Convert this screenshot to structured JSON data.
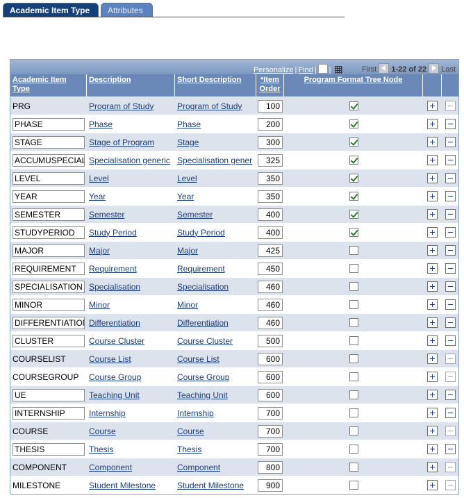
{
  "tabs": [
    {
      "label": "Academic Item Type",
      "active": true
    },
    {
      "label": "Attributes",
      "active": false
    }
  ],
  "nav": {
    "personalize": "Personalize",
    "find": "Find",
    "first": "First",
    "range": "1-22 of 22",
    "last": "Last"
  },
  "headers": {
    "academic_item_type": "Academic Item Type",
    "description": "Description",
    "short_description": "Short Description",
    "item_order": "*Item Order",
    "program_format_tree_node": "Program Format Tree Node"
  },
  "rows": [
    {
      "type": "PRG",
      "editable": false,
      "description": "Program of Study",
      "short": "Program of Study",
      "order": "100",
      "tree_node": true,
      "can_delete": false
    },
    {
      "type": "PHASE",
      "editable": true,
      "description": "Phase",
      "short": "Phase",
      "order": "200",
      "tree_node": true,
      "can_delete": true
    },
    {
      "type": "STAGE",
      "editable": true,
      "description": "Stage of Program",
      "short": "Stage",
      "order": "300",
      "tree_node": true,
      "can_delete": true
    },
    {
      "type": "ACCUMUSPECIAL",
      "editable": true,
      "description": "Specialisation generic",
      "short": "Specialisation gener",
      "order": "325",
      "tree_node": true,
      "can_delete": true
    },
    {
      "type": "LEVEL",
      "editable": true,
      "description": "Level",
      "short": "Level",
      "order": "350",
      "tree_node": true,
      "can_delete": true
    },
    {
      "type": "YEAR",
      "editable": true,
      "description": "Year",
      "short": "Year",
      "order": "350",
      "tree_node": true,
      "can_delete": true
    },
    {
      "type": "SEMESTER",
      "editable": true,
      "description": "Semester",
      "short": "Semester",
      "order": "400",
      "tree_node": true,
      "can_delete": true
    },
    {
      "type": "STUDYPERIOD",
      "editable": true,
      "description": "Study Period",
      "short": "Study Period",
      "order": "400",
      "tree_node": true,
      "can_delete": true
    },
    {
      "type": "MAJOR",
      "editable": true,
      "description": "Major",
      "short": "Major",
      "order": "425",
      "tree_node": false,
      "can_delete": true
    },
    {
      "type": "REQUIREMENT",
      "editable": true,
      "description": "Requirement",
      "short": "Requirement",
      "order": "450",
      "tree_node": false,
      "can_delete": true
    },
    {
      "type": "SPECIALISATION",
      "editable": true,
      "description": "Specialisation",
      "short": "Specialisation",
      "order": "460",
      "tree_node": false,
      "can_delete": true
    },
    {
      "type": "MINOR",
      "editable": true,
      "description": "Minor",
      "short": "Minor",
      "order": "460",
      "tree_node": false,
      "can_delete": true
    },
    {
      "type": "DIFFERENTIATION",
      "editable": true,
      "description": "Differentiation",
      "short": "Differentiation",
      "order": "460",
      "tree_node": false,
      "can_delete": true
    },
    {
      "type": "CLUSTER",
      "editable": true,
      "description": "Course Cluster",
      "short": "Course Cluster",
      "order": "500",
      "tree_node": false,
      "can_delete": true
    },
    {
      "type": "COURSELIST",
      "editable": false,
      "description": "Course List",
      "short": "Course List",
      "order": "600",
      "tree_node": false,
      "can_delete": false
    },
    {
      "type": "COURSEGROUP",
      "editable": false,
      "description": "Course Group",
      "short": "Course Group",
      "order": "600",
      "tree_node": false,
      "can_delete": false
    },
    {
      "type": "UE",
      "editable": true,
      "description": "Teaching Unit",
      "short": "Teaching Unit",
      "order": "600",
      "tree_node": false,
      "can_delete": true
    },
    {
      "type": "INTERNSHIP",
      "editable": true,
      "description": "Internship",
      "short": "Internship",
      "order": "700",
      "tree_node": false,
      "can_delete": true
    },
    {
      "type": "COURSE",
      "editable": false,
      "description": "Course",
      "short": "Course",
      "order": "700",
      "tree_node": false,
      "can_delete": false
    },
    {
      "type": "THESIS",
      "editable": true,
      "description": "Thesis",
      "short": "Thesis",
      "order": "700",
      "tree_node": false,
      "can_delete": true
    },
    {
      "type": "COMPONENT",
      "editable": false,
      "description": "Component",
      "short": "Component",
      "order": "800",
      "tree_node": false,
      "can_delete": false
    },
    {
      "type": "MILESTONE",
      "editable": false,
      "description": "Student Milestone",
      "short": "Student Milestone",
      "order": "900",
      "tree_node": false,
      "can_delete": false
    }
  ]
}
